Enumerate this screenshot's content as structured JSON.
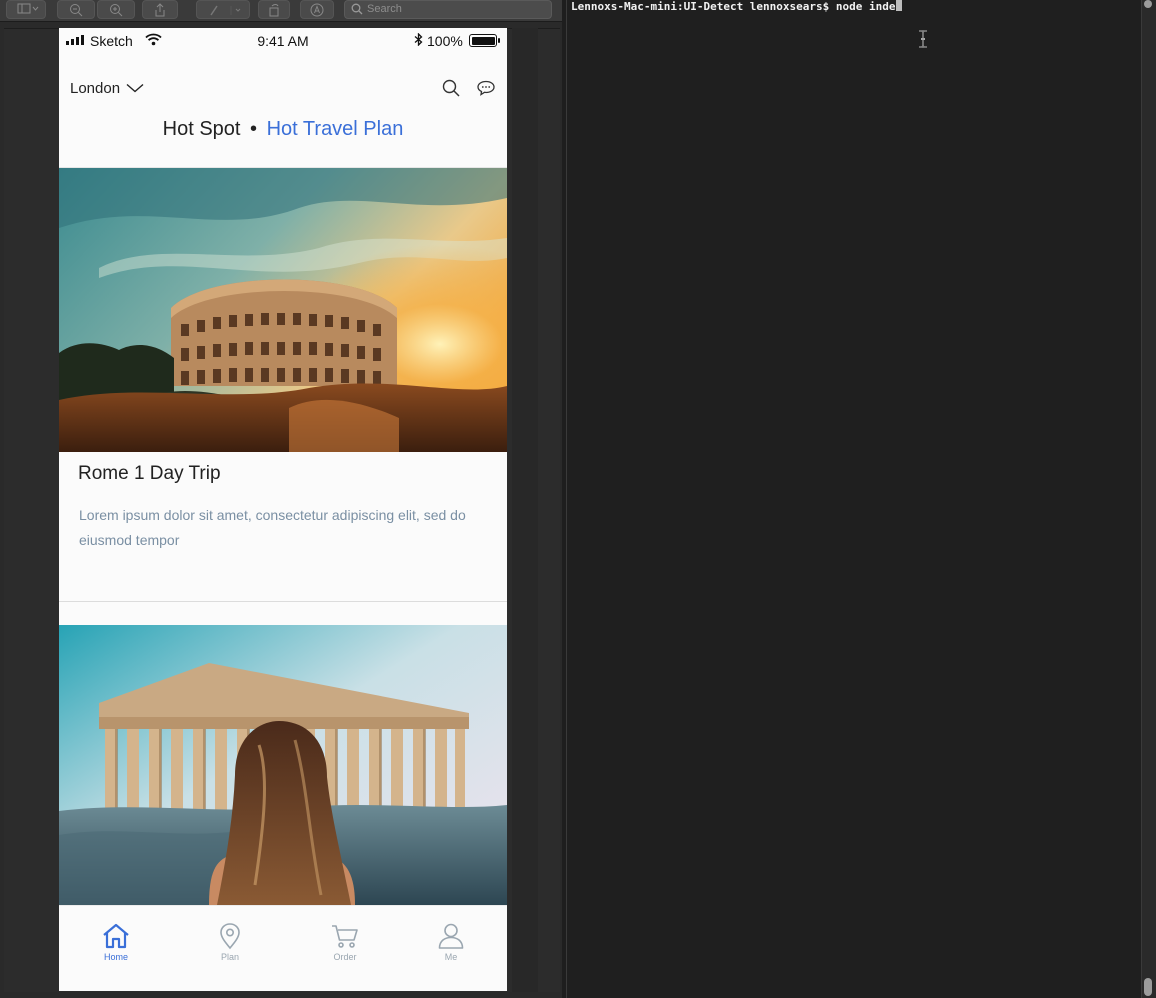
{
  "toolbar": {
    "search_placeholder": "Search"
  },
  "status_bar": {
    "carrier": "Sketch",
    "time": "9:41 AM",
    "battery": "100%"
  },
  "header": {
    "city": "London"
  },
  "tabs": {
    "hot_spot": "Hot Spot",
    "separator": "•",
    "hot_travel_plan": "Hot Travel Plan"
  },
  "card1": {
    "title": "Rome 1 Day Trip",
    "description": "Lorem ipsum dolor sit amet, consectetur adipiscing elit, sed do eiusmod tempor"
  },
  "tabbar": {
    "home": "Home",
    "plan": "Plan",
    "order": "Order",
    "me": "Me"
  },
  "terminal": {
    "prompt": "Lennoxs-Mac-mini:UI-Detect lennoxsears$ node inde"
  },
  "colors": {
    "accent": "#3a6fd8",
    "terminal_bg": "#1f1f1f"
  }
}
